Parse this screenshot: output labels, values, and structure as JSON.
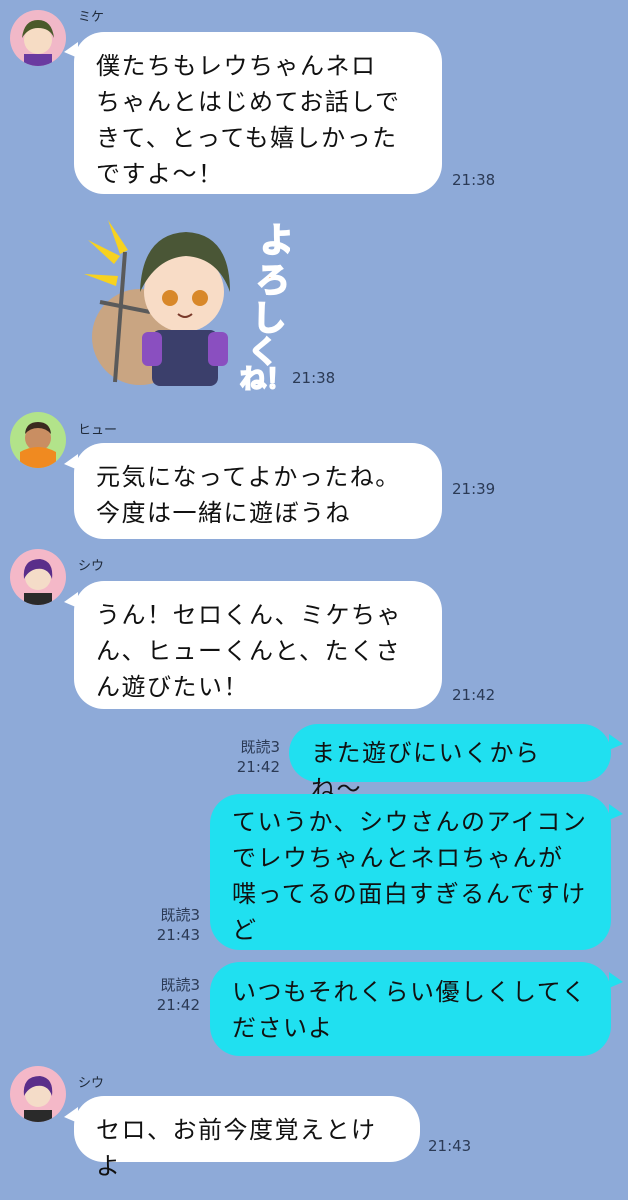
{
  "colors": {
    "background": "#8eaad8",
    "incoming_bubble": "#ffffff",
    "outgoing_bubble": "#20e0f0"
  },
  "messages": [
    {
      "sender": "ミケ",
      "text_lines": [
        "僕たちもレウちゃんネロ",
        "ちゃんとはじめてお話しで",
        "きて、とっても嬉しかった",
        "ですよ〜！"
      ],
      "time": "21:38"
    },
    {
      "sticker_text": "よろしくね！",
      "time": "21:38"
    },
    {
      "sender": "ヒュー",
      "text_lines": [
        "元気になってよかったね。",
        "今度は一緒に遊ぼうね"
      ],
      "time": "21:39"
    },
    {
      "sender": "シウ",
      "text_lines": [
        "うん！セロくん、ミケちゃ",
        "ん、ヒューくんと、たくさ",
        "ん遊びたい！"
      ],
      "time": "21:42"
    },
    {
      "read": "既読3",
      "text_lines": [
        "また遊びにいくからね〜"
      ],
      "time": "21:42"
    },
    {
      "read": "既読3",
      "text_lines": [
        "ていうか、シウさんのアイコン",
        "でレウちゃんとネロちゃんが",
        "喋ってるの面白すぎるんですけ",
        "ど"
      ],
      "time": "21:43"
    },
    {
      "read": "既読3",
      "text_lines": [
        "いつもそれくらい優しくしてく",
        "ださいよ"
      ],
      "time": "21:42"
    },
    {
      "sender": "シウ",
      "text_lines": [
        "セロ、お前今度覚えとけよ"
      ],
      "time": "21:43"
    }
  ]
}
